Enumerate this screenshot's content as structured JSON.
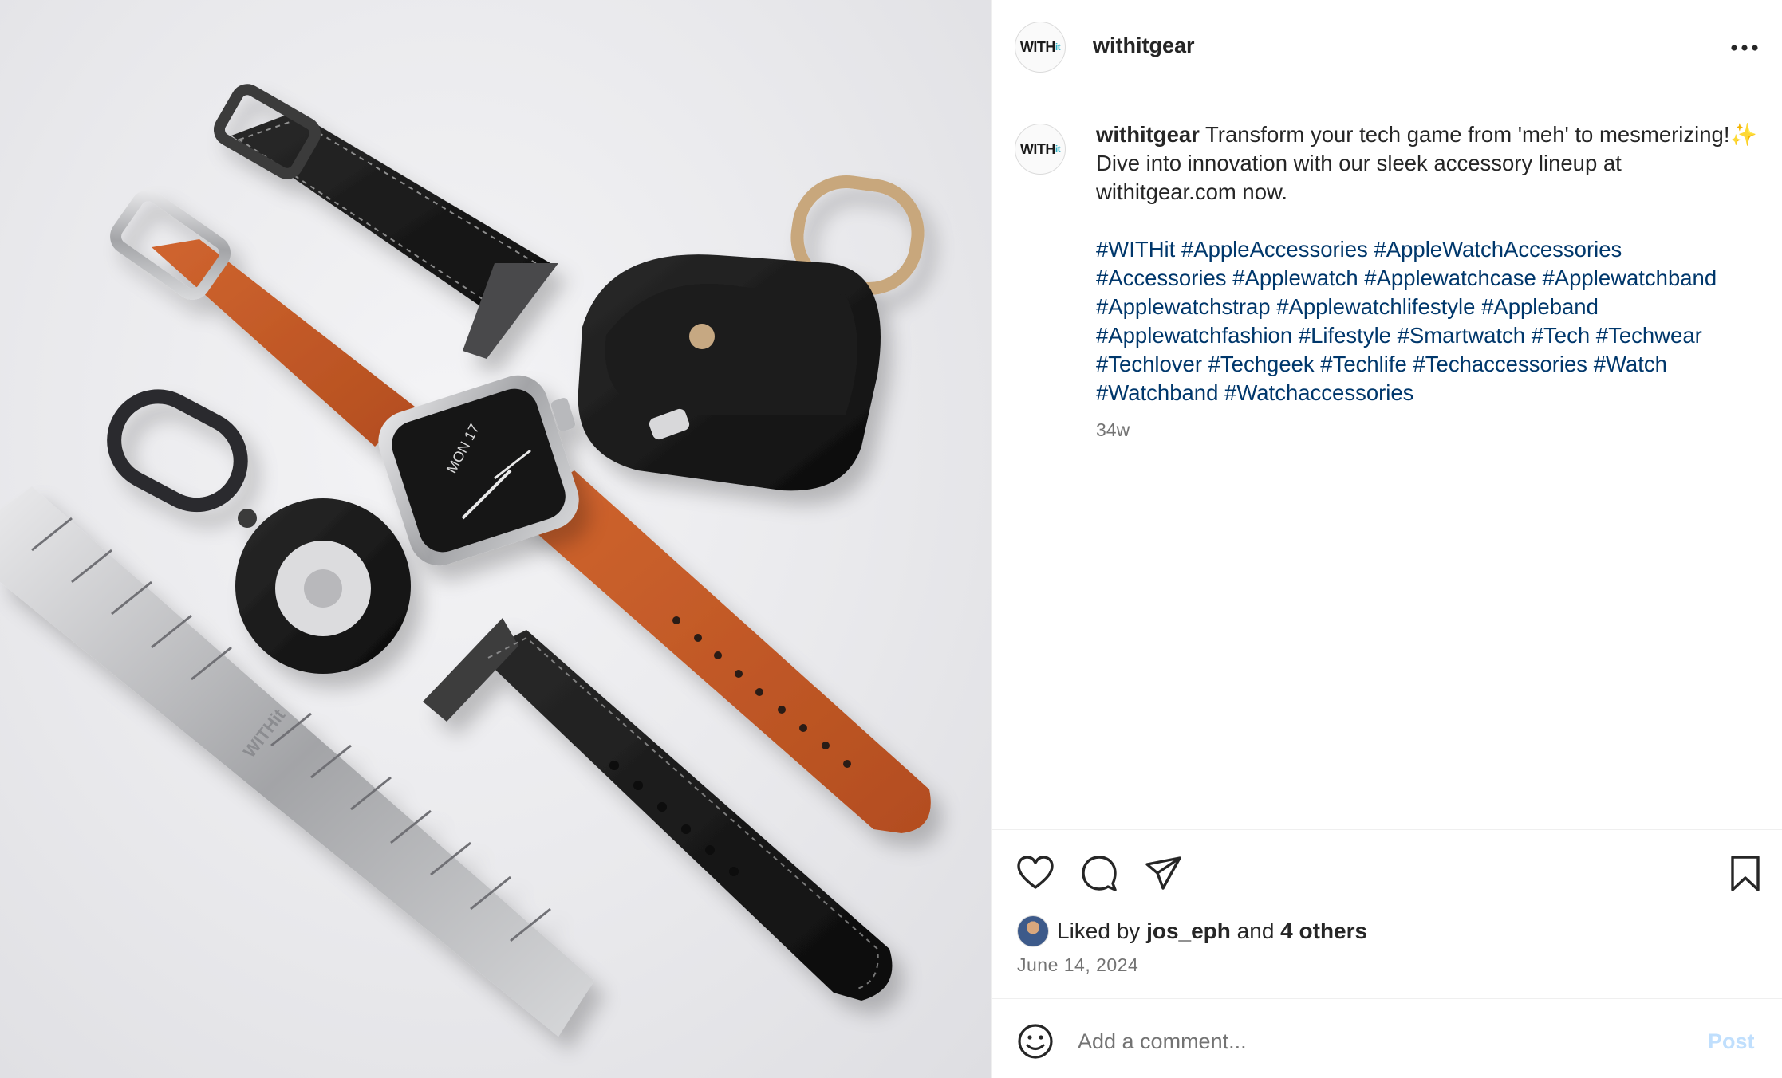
{
  "post": {
    "username": "withitgear",
    "avatar_text_main": "WITH",
    "avatar_text_accent": "it",
    "caption_username": "withitgear",
    "caption_text": "Transform your tech game from 'meh' to mesmerizing!✨ Dive into innovation with our sleek accessory lineup at withitgear.com now.",
    "hashtags": [
      "#WITHit",
      "#AppleAccessories",
      "#AppleWatchAccessories",
      "#Accessories",
      "#Applewatch",
      "#Applewatchcase",
      "#Applewatchband",
      "#Applewatchstrap",
      "#Applewatchlifestyle",
      "#Appleband",
      "#Applewatchfashion",
      "#Lifestyle",
      "#Smartwatch",
      "#Tech",
      "#Techwear",
      "#Techlover",
      "#Techgeek",
      "#Techlife",
      "#Techaccessories",
      "#Watch",
      "#Watchband",
      "#Watchaccessories"
    ],
    "time_ago": "34w",
    "likes": {
      "prefix": "Liked by",
      "user": "jos_eph",
      "conjunction": "and",
      "others": "4 others"
    },
    "date": "June 14, 2024"
  },
  "photo": {
    "watch_face_date": "MON 17",
    "buckle_engraving": "WITHit"
  },
  "comment_box": {
    "placeholder": "Add a comment...",
    "post_label": "Post"
  },
  "icons": {
    "more": "more-options-icon",
    "like": "heart-icon",
    "comment": "comment-icon",
    "share": "paper-plane-icon",
    "save": "bookmark-icon",
    "emoji": "emoji-icon"
  },
  "colors": {
    "hashtag": "#00376b",
    "secondary_text": "#737373",
    "post_button_disabled": "#c0dffd",
    "strap_orange": "#c5592a"
  }
}
